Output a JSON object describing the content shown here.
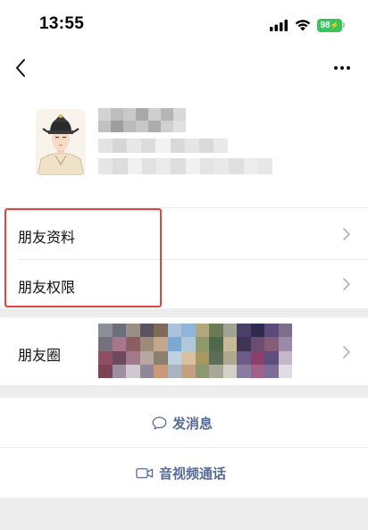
{
  "status_bar": {
    "time": "13:55",
    "battery": "98",
    "battery_color": "#34c759"
  },
  "nav": {
    "back_icon": "chevron-left-icon",
    "more_icon": "more-dots-icon"
  },
  "profile": {
    "avatar": "avatar-portrait",
    "name": "",
    "id": ""
  },
  "menu": {
    "items": [
      {
        "label": "朋友资料"
      },
      {
        "label": "朋友权限"
      },
      {
        "label": "朋友圈"
      }
    ]
  },
  "actions": {
    "send_message": "发消息",
    "av_call": "音视频通话",
    "link_color": "#576b95"
  },
  "highlight_color": "#e0453f"
}
